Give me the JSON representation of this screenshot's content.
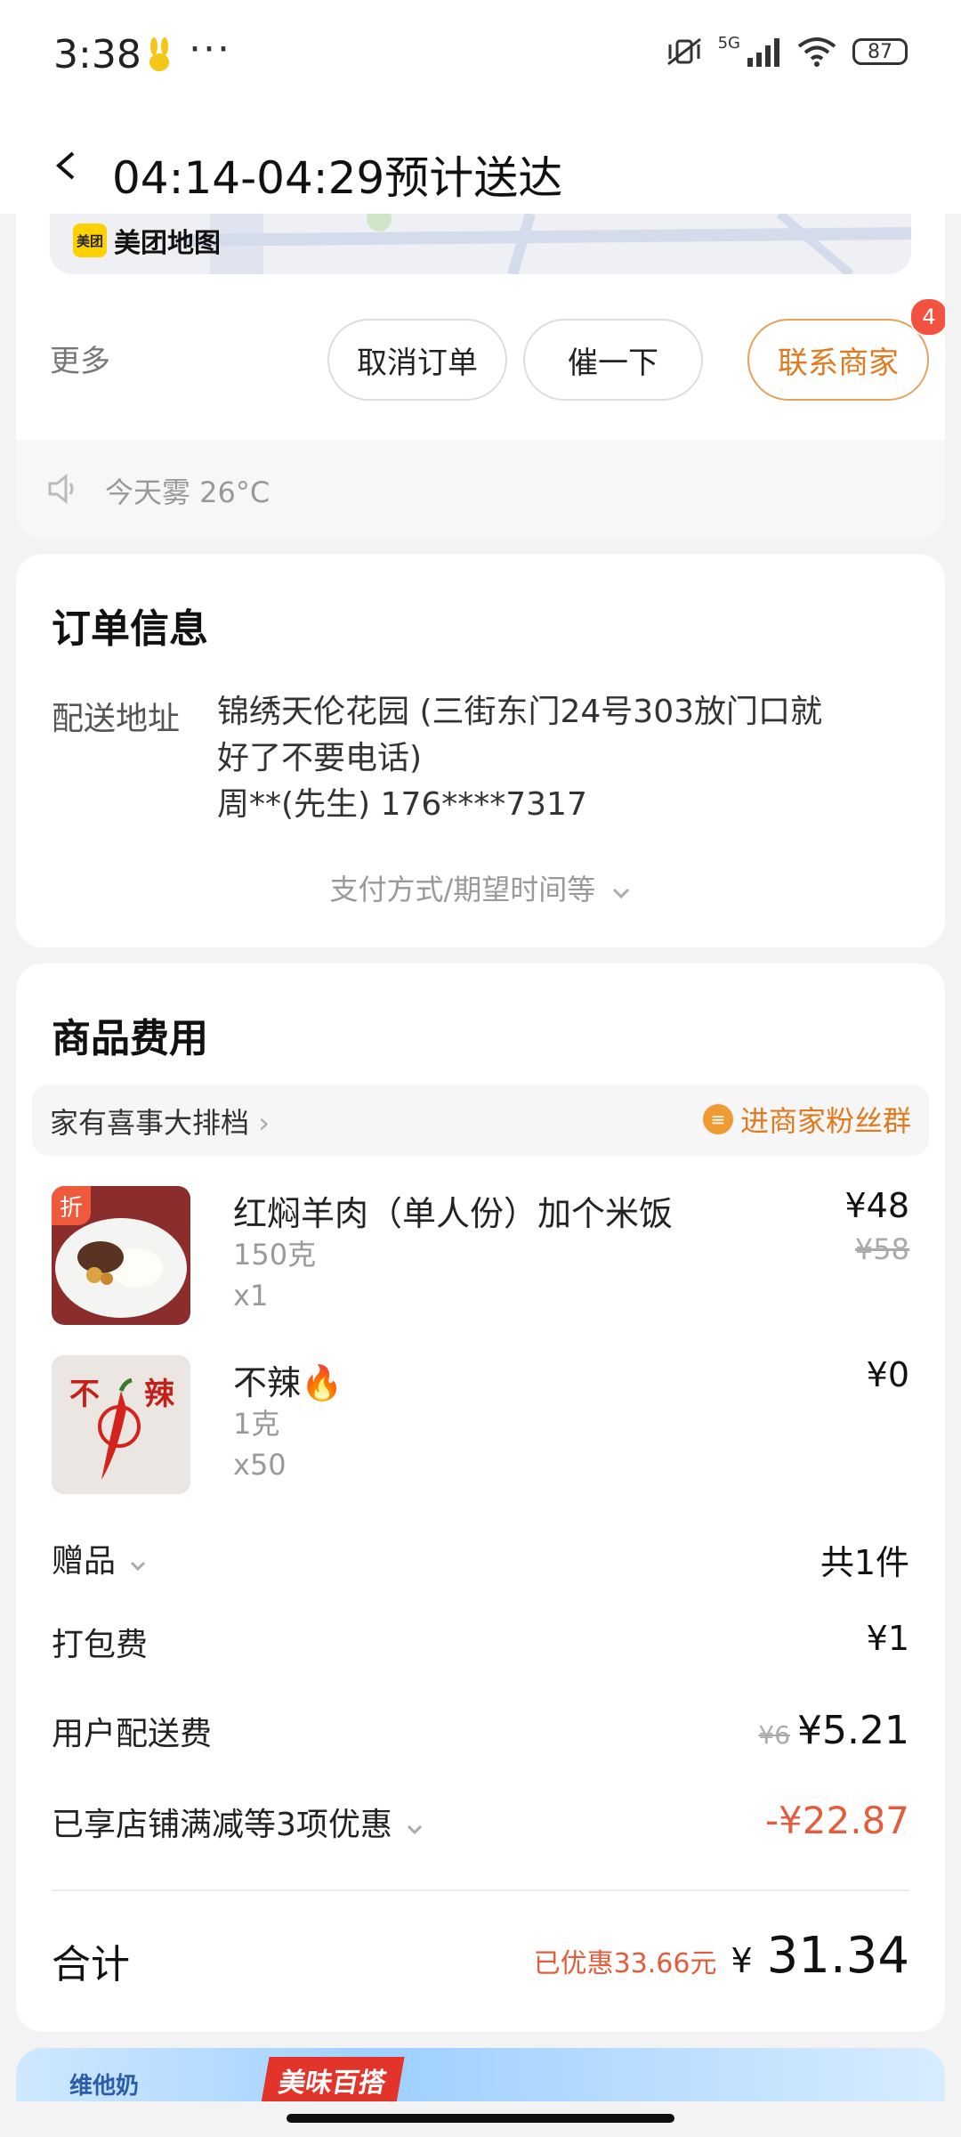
{
  "status_bar": {
    "time": "3:38",
    "network": "5G",
    "battery": "87"
  },
  "header": {
    "title": "04:14-04:29预计送达"
  },
  "map": {
    "logo_text": "美团",
    "label": "美团地图"
  },
  "actions": {
    "more": "更多",
    "cancel": "取消订单",
    "urge": "催一下",
    "contact": "联系商家",
    "contact_badge": "4"
  },
  "weather": {
    "text": "今天雾 26°C"
  },
  "order_info": {
    "title": "订单信息",
    "address_label": "配送地址",
    "address_line1": "锦绣天伦花园 (三街东门24号303放门口就",
    "address_line2": "好了不要电话)",
    "contact_line": "周**(先生) 176****7317",
    "pay_link": "支付方式/期望时间等"
  },
  "fees": {
    "title": "商品费用",
    "shop_name": "家有喜事大排档",
    "fans_group": "进商家粉丝群",
    "items": [
      {
        "tag": "折",
        "name": "红焖羊肉（单人份）加个米饭",
        "spec": "150克",
        "qty": "x1",
        "price": "¥48",
        "orig_price": "¥58"
      },
      {
        "thumb_text_left": "不",
        "thumb_text_right": "辣",
        "name": "不辣🔥",
        "spec": "1克",
        "qty": "x50",
        "price": "¥0"
      }
    ],
    "gift_label": "赠品",
    "gift_value": "共1件",
    "packing_label": "打包费",
    "packing_value": "¥1",
    "delivery_label": "用户配送费",
    "delivery_orig": "¥6",
    "delivery_value": "¥5.21",
    "discount_label": "已享店铺满减等3项优惠",
    "discount_value": "-¥22.87",
    "total_label": "合计",
    "saved_text": "已优惠33.66元",
    "total_currency": "¥",
    "total_value": "31.34"
  },
  "banner": {
    "brand": "维他奶",
    "promo": "美味百搭"
  },
  "colors": {
    "accent_orange": "#e07a1f",
    "price_red": "#e35d3c",
    "badge_red": "#f2523f"
  }
}
